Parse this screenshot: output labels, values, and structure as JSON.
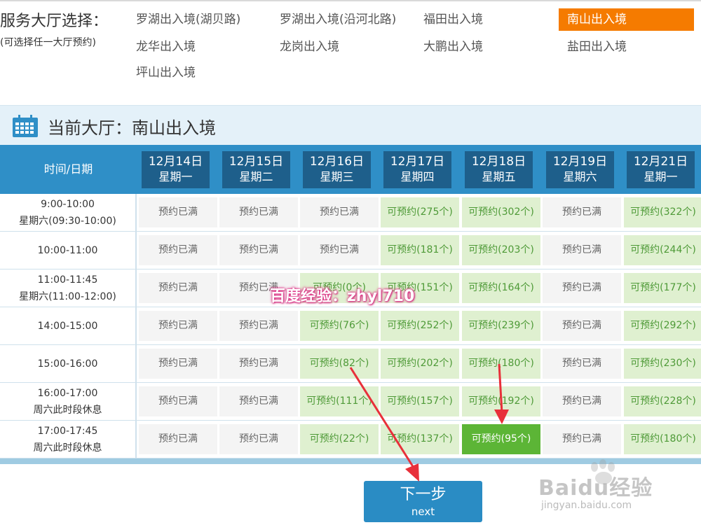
{
  "hall_select": {
    "title": "服务大厅选择：",
    "subtitle": "(可选择任一大厅预约)",
    "halls": [
      {
        "label": "罗湖出入境(湖贝路)",
        "selected": false
      },
      {
        "label": "罗湖出入境(沿河北路)",
        "selected": false
      },
      {
        "label": "福田出入境",
        "selected": false
      },
      {
        "label": "南山出入境",
        "selected": true
      },
      {
        "label": "龙华出入境",
        "selected": false
      },
      {
        "label": "龙岗出入境",
        "selected": false
      },
      {
        "label": "大鹏出入境",
        "selected": false
      },
      {
        "label": "盐田出入境",
        "selected": false
      },
      {
        "label": "坪山出入境",
        "selected": false
      }
    ]
  },
  "current_hall": {
    "icon": "calendar-icon",
    "title": "当前大厅：南山出入境"
  },
  "schedule": {
    "time_header": "时间/日期",
    "dates": [
      {
        "date": "12月14日",
        "weekday": "星期一"
      },
      {
        "date": "12月15日",
        "weekday": "星期二"
      },
      {
        "date": "12月16日",
        "weekday": "星期三"
      },
      {
        "date": "12月17日",
        "weekday": "星期四"
      },
      {
        "date": "12月18日",
        "weekday": "星期五"
      },
      {
        "date": "12月19日",
        "weekday": "星期六"
      },
      {
        "date": "12月21日",
        "weekday": "星期一"
      }
    ],
    "rows": [
      {
        "time": "9:00-10:00",
        "note": "星期六(09:30-10:00)",
        "cells": [
          {
            "text": "预约已满",
            "status": "full"
          },
          {
            "text": "预约已满",
            "status": "full"
          },
          {
            "text": "预约已满",
            "status": "full"
          },
          {
            "text": "可预约(275个)",
            "status": "available"
          },
          {
            "text": "可预约(302个)",
            "status": "available"
          },
          {
            "text": "预约已满",
            "status": "full"
          },
          {
            "text": "可预约(322个)",
            "status": "available"
          }
        ]
      },
      {
        "time": "10:00-11:00",
        "note": "",
        "cells": [
          {
            "text": "预约已满",
            "status": "full"
          },
          {
            "text": "预约已满",
            "status": "full"
          },
          {
            "text": "预约已满",
            "status": "full"
          },
          {
            "text": "可预约(181个)",
            "status": "available"
          },
          {
            "text": "可预约(203个)",
            "status": "available"
          },
          {
            "text": "预约已满",
            "status": "full"
          },
          {
            "text": "可预约(244个)",
            "status": "available"
          }
        ]
      },
      {
        "time": "11:00-11:45",
        "note": "星期六(11:00-12:00)",
        "cells": [
          {
            "text": "预约已满",
            "status": "full"
          },
          {
            "text": "预约已满",
            "status": "full"
          },
          {
            "text": "可预约(0个)",
            "status": "available"
          },
          {
            "text": "可预约(151个)",
            "status": "available"
          },
          {
            "text": "可预约(164个)",
            "status": "available"
          },
          {
            "text": "预约已满",
            "status": "full"
          },
          {
            "text": "可预约(177个)",
            "status": "available"
          }
        ]
      },
      {
        "time": "14:00-15:00",
        "note": "",
        "cells": [
          {
            "text": "预约已满",
            "status": "full"
          },
          {
            "text": "预约已满",
            "status": "full"
          },
          {
            "text": "可预约(76个)",
            "status": "available"
          },
          {
            "text": "可预约(252个)",
            "status": "available"
          },
          {
            "text": "可预约(239个)",
            "status": "available"
          },
          {
            "text": "预约已满",
            "status": "full"
          },
          {
            "text": "可预约(292个)",
            "status": "available"
          }
        ]
      },
      {
        "time": "15:00-16:00",
        "note": "",
        "cells": [
          {
            "text": "预约已满",
            "status": "full"
          },
          {
            "text": "预约已满",
            "status": "full"
          },
          {
            "text": "可预约(82个)",
            "status": "available"
          },
          {
            "text": "可预约(202个)",
            "status": "available"
          },
          {
            "text": "可预约(180个)",
            "status": "available"
          },
          {
            "text": "预约已满",
            "status": "full"
          },
          {
            "text": "可预约(230个)",
            "status": "available"
          }
        ]
      },
      {
        "time": "16:00-17:00",
        "note": "周六此时段休息",
        "cells": [
          {
            "text": "预约已满",
            "status": "full"
          },
          {
            "text": "预约已满",
            "status": "full"
          },
          {
            "text": "可预约(111个)",
            "status": "available"
          },
          {
            "text": "可预约(157个)",
            "status": "available"
          },
          {
            "text": "可预约(192个)",
            "status": "available"
          },
          {
            "text": "预约已满",
            "status": "full"
          },
          {
            "text": "可预约(228个)",
            "status": "available"
          }
        ]
      },
      {
        "time": "17:00-17:45",
        "note": "周六此时段休息",
        "cells": [
          {
            "text": "预约已满",
            "status": "full"
          },
          {
            "text": "预约已满",
            "status": "full"
          },
          {
            "text": "可预约(22个)",
            "status": "available"
          },
          {
            "text": "可预约(137个)",
            "status": "available"
          },
          {
            "text": "可预约(95个)",
            "status": "selected"
          },
          {
            "text": "预约已满",
            "status": "full"
          },
          {
            "text": "可预约(180个)",
            "status": "available"
          }
        ]
      }
    ]
  },
  "next_button": {
    "label_zh": "下一步",
    "label_en": "next"
  },
  "watermark": "百度经验：zhyl710",
  "branding": {
    "logo_text": "Baidu经验",
    "url": "jingyan.baidu.com"
  },
  "colors": {
    "selected_hall": "#f57b00",
    "header_blue": "#2f8fc7",
    "date_box": "#1e5f8b",
    "available_bg": "#dff0d0",
    "available_text": "#4e9a37",
    "selected_cell": "#5cb536",
    "full_bg": "#f4f4f4",
    "button": "#2a8cc4",
    "annotation_arrow": "#e8303a"
  }
}
